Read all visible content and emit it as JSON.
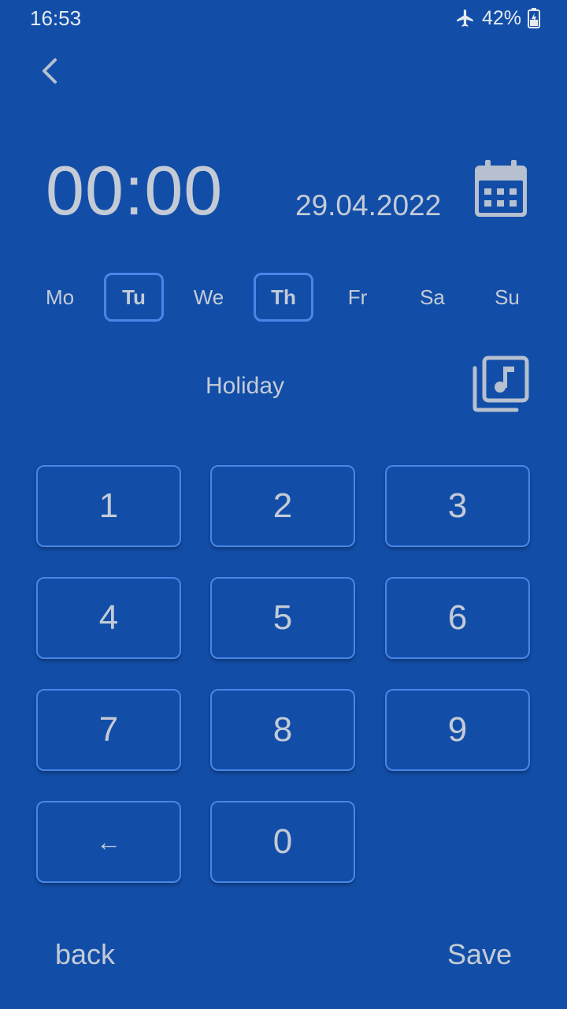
{
  "status_bar": {
    "time": "16:53",
    "battery": "42%",
    "icons": [
      "airplane-mode-icon",
      "battery-charging-icon"
    ]
  },
  "header": {
    "back_icon": "chevron-left-icon"
  },
  "alarm": {
    "time": "00:00",
    "date": "29.04.2022",
    "calendar_icon": "calendar-icon"
  },
  "weekdays": [
    {
      "label": "Mo",
      "selected": false
    },
    {
      "label": "Tu",
      "selected": true
    },
    {
      "label": "We",
      "selected": false
    },
    {
      "label": "Th",
      "selected": true
    },
    {
      "label": "Fr",
      "selected": false
    },
    {
      "label": "Sa",
      "selected": false
    },
    {
      "label": "Su",
      "selected": false
    }
  ],
  "holiday": {
    "label": "Holiday",
    "music_icon": "music-library-icon"
  },
  "keypad": {
    "k1": "1",
    "k2": "2",
    "k3": "3",
    "k4": "4",
    "k5": "5",
    "k6": "6",
    "k7": "7",
    "k8": "8",
    "k9": "9",
    "backspace": "←",
    "k0": "0"
  },
  "actions": {
    "back": "back",
    "save": "Save"
  },
  "colors": {
    "background": "#124ea8",
    "accent_border": "#4a86e8",
    "text": "#c4cbd6"
  }
}
